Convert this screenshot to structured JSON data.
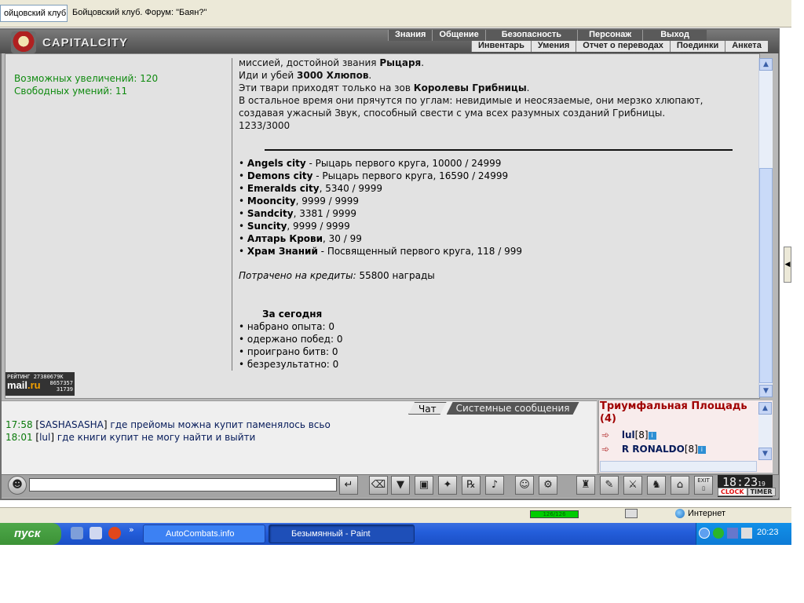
{
  "browser": {
    "tabs": [
      {
        "label": "ойцовский клуб"
      },
      {
        "label": "Бойцовский клуб. Форум: \"Баян?\""
      }
    ]
  },
  "header": {
    "logo_text": "CAPITALCITY",
    "nav_top": [
      "Знания",
      "Общение",
      "Безопасность",
      "Персонаж",
      "Выход"
    ],
    "nav_bottom": [
      "Инвентарь",
      "Умения",
      "Отчет о переводах",
      "Поединки",
      "Анкета"
    ]
  },
  "left": {
    "increases": "Возможных увеличений: 120",
    "skills": "Свободных умений: 11"
  },
  "quest": {
    "line1_a": "миссией, достойной звания ",
    "line1_b": "Рыцаря",
    "line1_c": ".",
    "line2_a": "Иди и убей ",
    "line2_b": "3000 Хлюпов",
    "line2_c": ".",
    "line3_a": "Эти твари приходят только на зов ",
    "line3_b": "Королевы Грибницы",
    "line3_c": ".",
    "line4": "В остальное время они прячутся по углам: невидимые и неосязаемые, они мерзко хлюпают,",
    "line5": "создавая ужасный Звук, способный свести с ума всех разумных созданий Грибницы.",
    "progress": "1233/3000"
  },
  "cities": [
    {
      "name": "Angels city",
      "detail": " - Рыцарь первого круга, 10000 / 24999"
    },
    {
      "name": "Demons city",
      "detail": " - Рыцарь первого круга, 16590 / 24999"
    },
    {
      "name": "Emeralds city",
      "detail": ", 5340 / 9999"
    },
    {
      "name": "Mooncity",
      "detail": ", 9999 / 9999"
    },
    {
      "name": "Sandcity",
      "detail": ", 3381 / 9999"
    },
    {
      "name": "Suncity",
      "detail": ", 9999 / 9999"
    },
    {
      "name": "Алтарь Крови",
      "detail": ", 30 / 99"
    },
    {
      "name": "Храм Знаний",
      "detail": " - Посвященный первого круга, 118 / 999"
    }
  ],
  "credits": {
    "label": "Потрачено на кредиты:",
    "value": " 55800 награды"
  },
  "today": {
    "title": "За сегодня",
    "items": [
      "• набрано опыта: 0",
      "• одержано побед: 0",
      "• проиграно битв: 0",
      "• безрезультатно: 0"
    ]
  },
  "rating": {
    "top": "РЕЙТИНГ 27380679K",
    "brand_a": "mail",
    "brand_b": ".ru",
    "n1": "8657357",
    "n2": "31739"
  },
  "chat": {
    "tab_chat": "Чат",
    "tab_system": "Системные сообщения",
    "lines": [
      {
        "time": "17:58",
        "nick": "SASHASASHA",
        "msg": " где прейомы можна купит паменялось всьо"
      },
      {
        "time": "18:01",
        "nick": "lul",
        "msg": " где книги купит не могу найти и выйти"
      }
    ]
  },
  "room": {
    "title": "Триумфальная Площадь (4)",
    "users": [
      {
        "name": "lul",
        "level": "[8]"
      },
      {
        "name": "R RONALDO",
        "level": "[8]"
      }
    ]
  },
  "clock": {
    "time": "18:23",
    "sec": "19",
    "clock_label": "CLOCK",
    "timer_label": "TIMER",
    "exit_label": "EXIT"
  },
  "statusbar": {
    "progress_text": "126/126",
    "zone": "Интернет"
  },
  "taskbar": {
    "start": "пуск",
    "tasks": [
      "AutoCombats.info",
      "Безымянный - Paint"
    ],
    "clock": "20:23"
  },
  "colors": {
    "green_text": "#0f8a0f",
    "chat_time": "#0a7a0a",
    "room_title": "#a00000",
    "taskbar": "#245edb"
  }
}
